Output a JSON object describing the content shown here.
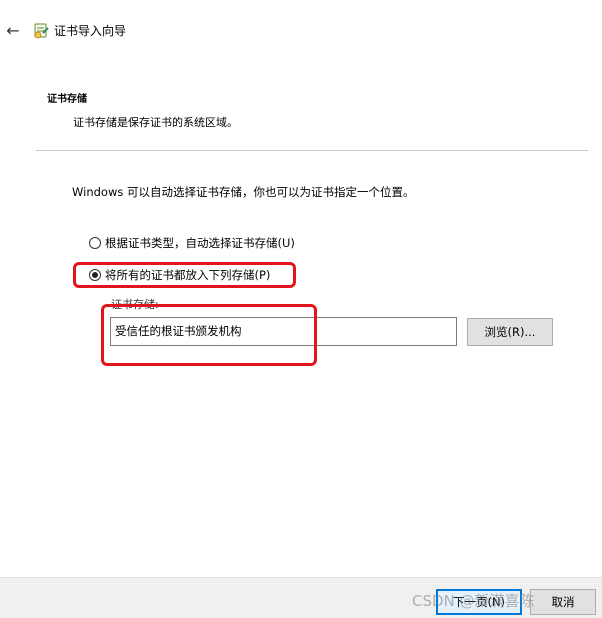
{
  "window": {
    "title": "证书导入向导",
    "back_icon": "arrow-left-icon",
    "app_icon": "certificate-icon"
  },
  "header": {
    "section_title": "证书存储",
    "section_desc": "证书存储是保存证书的系统区域。"
  },
  "body": {
    "intro": "Windows 可以自动选择证书存储，你也可以为证书指定一个位置。",
    "options": [
      {
        "label": "根据证书类型，自动选择证书存储(U)",
        "checked": false
      },
      {
        "label": "将所有的证书都放入下列存储(P)",
        "checked": true
      }
    ],
    "store": {
      "label": "证书存储:",
      "value": "受信任的根证书颁发机构",
      "browse_label": "浏览(R)..."
    }
  },
  "footer": {
    "next_label": "下一页(N)",
    "cancel_label": "取消",
    "watermark": "CSDN @新滿喜陈"
  },
  "colors": {
    "highlight": "#e3141b",
    "accent": "#0078d7",
    "footer_bg": "#f0f0f0"
  }
}
